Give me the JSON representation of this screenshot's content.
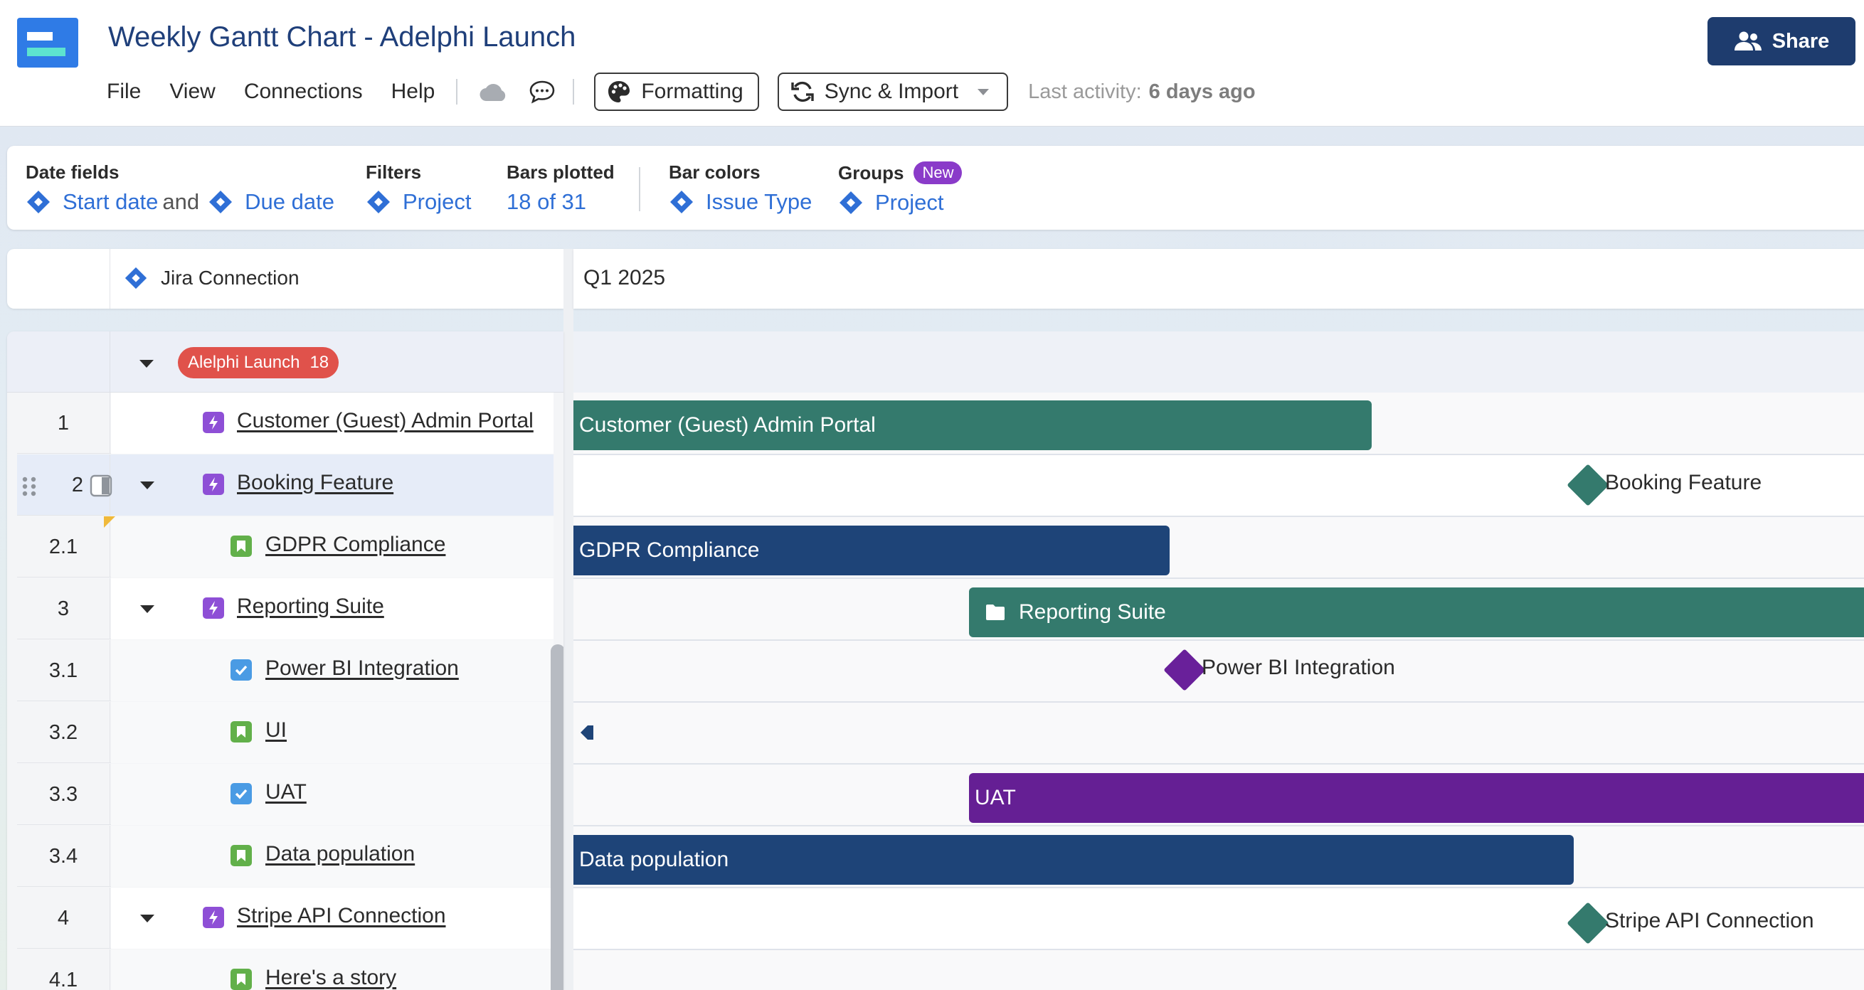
{
  "header": {
    "title": "Weekly Gantt Chart - Adelphi Launch",
    "menu": [
      "File",
      "View",
      "Connections",
      "Help"
    ],
    "formatting_label": "Formatting",
    "sync_label": "Sync & Import",
    "last_activity_label": "Last activity:",
    "last_activity_value": "6 days ago",
    "share_label": "Share",
    "icons": [
      "cloud-icon",
      "comment-icon",
      "palette-icon",
      "sync-icon",
      "users-icon"
    ]
  },
  "settings": {
    "date_fields_label": "Date fields",
    "start_date": "Start date",
    "and_text": "and",
    "due_date": "Due date",
    "filters_label": "Filters",
    "filters_value": "Project",
    "bars_plotted_label": "Bars plotted",
    "bars_plotted_value": "18 of 31",
    "bar_colors_label": "Bar colors",
    "bar_colors_value": "Issue Type",
    "groups_label": "Groups",
    "groups_badge": "New",
    "groups_value": "Project"
  },
  "table": {
    "connection_label": "Jira Connection",
    "timeline_label": "Q1 2025",
    "group": {
      "name": "Alelphi Launch",
      "count": "18"
    },
    "rows": [
      {
        "num": "1",
        "title": "Customer (Guest) Admin Portal",
        "type": "epic"
      },
      {
        "num": "2",
        "title": "Booking Feature",
        "type": "epic"
      },
      {
        "num": "2.1",
        "title": "GDPR Compliance",
        "type": "story"
      },
      {
        "num": "3",
        "title": "Reporting Suite",
        "type": "epic"
      },
      {
        "num": "3.1",
        "title": "Power BI Integration",
        "type": "task"
      },
      {
        "num": "3.2",
        "title": "UI",
        "type": "story"
      },
      {
        "num": "3.3",
        "title": "UAT",
        "type": "task"
      },
      {
        "num": "3.4",
        "title": "Data population",
        "type": "story"
      },
      {
        "num": "4",
        "title": "Stripe API Connection",
        "type": "epic"
      },
      {
        "num": "4.1",
        "title": "Here's a story",
        "type": "story"
      }
    ]
  },
  "gantt": {
    "bars": [
      {
        "label": "Customer (Guest) Admin Portal",
        "color": "#347a6d"
      },
      {
        "label": "Booking Feature",
        "color": "#347a6d",
        "kind": "milestone"
      },
      {
        "label": "GDPR Compliance",
        "color": "#1e4478"
      },
      {
        "label": "Reporting Suite",
        "color": "#347a6d"
      },
      {
        "label": "Power BI Integration",
        "color": "#69209a",
        "kind": "milestone"
      },
      {
        "label": "UAT",
        "color": "#651f94"
      },
      {
        "label": "Data population",
        "color": "#1e4478"
      },
      {
        "label": "Stripe API Connection",
        "color": "#347a6d",
        "kind": "milestone"
      }
    ]
  },
  "colors": {
    "epic": "#8e4fd6",
    "story": "#62b04a",
    "task": "#4a9be4",
    "group_pill": "#e0524b",
    "accent": "#2f6fd6",
    "share": "#1e3c6e"
  }
}
